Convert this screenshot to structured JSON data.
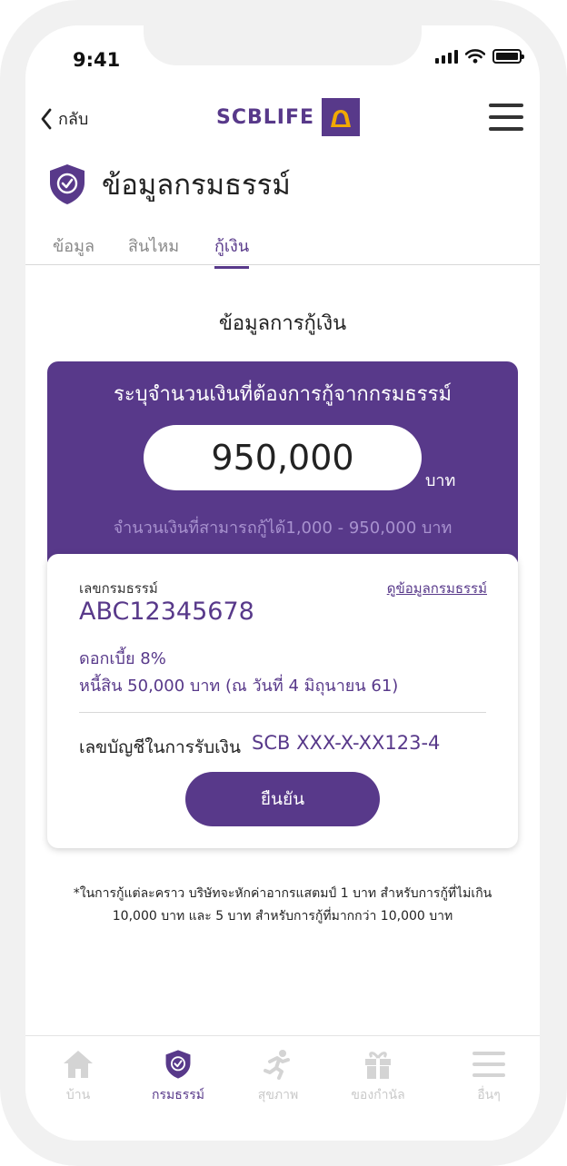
{
  "status_bar": {
    "time": "9:41"
  },
  "nav": {
    "back_label": "กลับ",
    "brand": "SCBLIFE"
  },
  "page": {
    "title": "ข้อมูลกรมธรรม์"
  },
  "tabs": [
    {
      "label": "ข้อมูล",
      "active": false
    },
    {
      "label": "สินไหม",
      "active": false
    },
    {
      "label": "กู้เงิน",
      "active": true
    }
  ],
  "section_title": "ข้อมูลการกู้เงิน",
  "loan": {
    "heading": "ระบุจำนวนเงินที่ต้องการกู้จากกรมธรรม์",
    "amount": "950,000",
    "unit": "บาท",
    "range_text": "จำนวนเงินที่สามารถกู้ได้1,000 - 950,000 บาท"
  },
  "policy": {
    "label": "เลขกรมธรรม์",
    "view_link": "ดูข้อมูลกรมธรรม์",
    "number": "ABC12345678",
    "interest": "ดอกเบี้ย 8%",
    "debt": "หนี้สิน 50,000 บาท (ณ วันที่ 4 มิถุนายน 61)",
    "account_label": "เลขบัญชีในการรับเงิน",
    "account_value": "SCB XXX-X-XX123-4",
    "confirm_label": "ยืนยัน"
  },
  "footnote": {
    "line1": "*ในการกู้แต่ละคราว บริษัทจะหักค่าอากรแสตมป์ 1 บาท สำหรับการกู้ที่ไม่เกิน",
    "line2": "10,000 บาท และ 5 บาท สำหรับการกู้ที่มากกว่า 10,000 บาท"
  },
  "bottom_nav": [
    {
      "label": "บ้าน",
      "icon": "home-icon",
      "active": false
    },
    {
      "label": "กรมธรรม์",
      "icon": "shield-check-icon",
      "active": true
    },
    {
      "label": "สุขภาพ",
      "icon": "running-person-icon",
      "active": false
    },
    {
      "label": "ของกำนัล",
      "icon": "gift-icon",
      "active": false
    },
    {
      "label": "อื่นๆ",
      "icon": "menu-icon",
      "active": false
    }
  ],
  "colors": {
    "primary": "#58398a",
    "inactive": "#c9c9c9",
    "muted_text": "#a892cf"
  }
}
